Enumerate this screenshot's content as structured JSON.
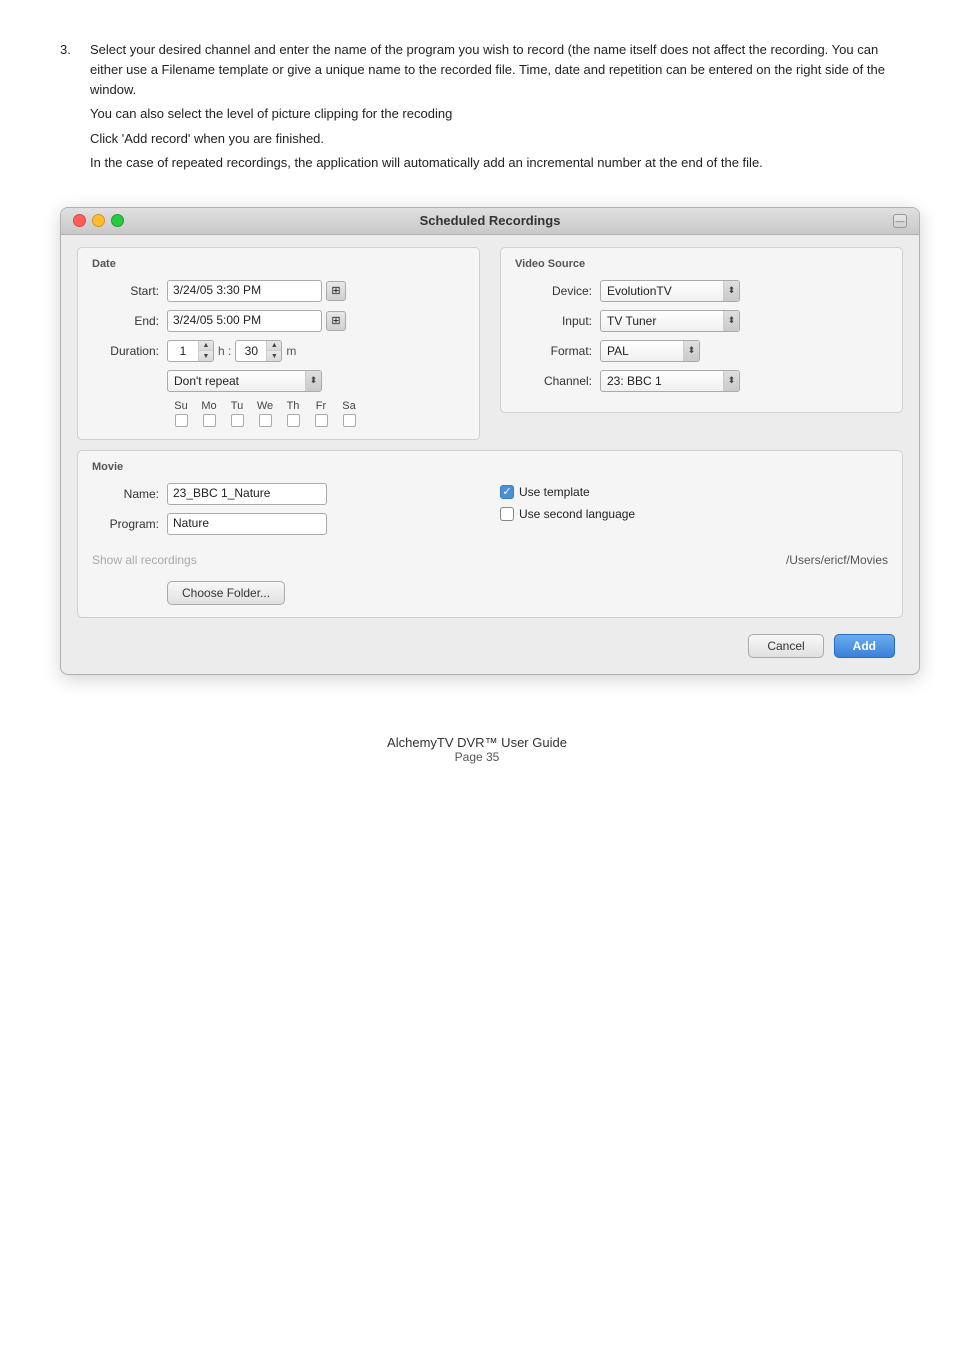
{
  "instruction": {
    "step_number": "3.",
    "paragraph1": "Select your desired channel and enter the name of the program you wish to record (the name itself does not affect the recording. You can either use a Filename template or give a unique name to the recorded file. Time, date and repetition can be entered  on the right side of the window.",
    "paragraph2": "You can also select the level of picture clipping for the recoding",
    "paragraph3": "Click 'Add record' when you are finished.",
    "paragraph4": "In the case of repeated recordings, the application will automatically add an incremental number at the end of the file."
  },
  "window": {
    "title": "Scheduled Recordings",
    "traffic_lights": [
      "close",
      "minimize",
      "maximize"
    ]
  },
  "date_section": {
    "header": "Date",
    "start_label": "Start:",
    "start_value": "3/24/05 3:30 PM",
    "end_label": "End:",
    "end_value": "3/24/05 5:00 PM",
    "duration_label": "Duration:",
    "duration_hours": "1",
    "duration_minutes": "30",
    "hours_sep": "h :",
    "min_sep": "m",
    "repeat_label": "",
    "repeat_value": "Don't repeat",
    "days": [
      "Su",
      "Mo",
      "Tu",
      "We",
      "Th",
      "Fr",
      "Sa"
    ]
  },
  "video_source": {
    "header": "Video Source",
    "device_label": "Device:",
    "device_value": "EvolutionTV",
    "input_label": "Input:",
    "input_value": "TV Tuner",
    "format_label": "Format:",
    "format_value": "PAL",
    "channel_label": "Channel:",
    "channel_value": "23: BBC 1"
  },
  "movie_section": {
    "header": "Movie",
    "name_label": "Name:",
    "name_value": "23_BBC 1_Nature",
    "program_label": "Program:",
    "program_value": "Nature",
    "use_template_label": "Use template",
    "use_template_checked": true,
    "use_second_language_label": "Use second language",
    "use_second_language_checked": false,
    "show_all_label": "Show all recordings",
    "folder_path": "/Users/ericf/Movies",
    "choose_folder_label": "Choose Folder..."
  },
  "buttons": {
    "cancel_label": "Cancel",
    "add_label": "Add"
  },
  "footer": {
    "app_name": "AlchemyTV DVR™ User Guide",
    "page_label": "Page 35"
  }
}
